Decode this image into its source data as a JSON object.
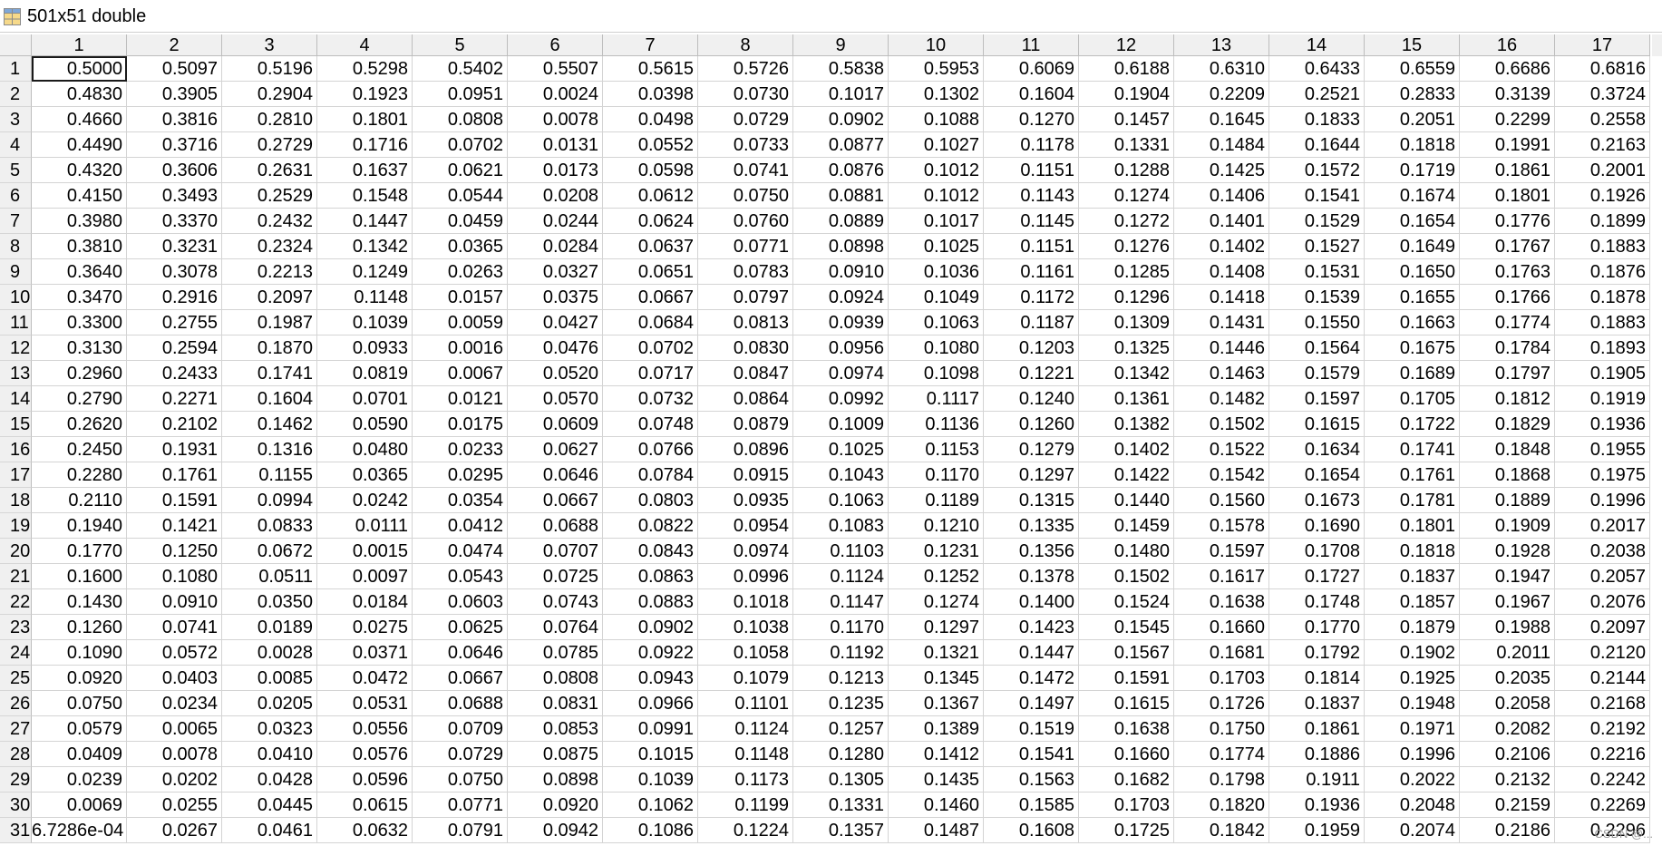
{
  "window": {
    "title": "501x51 double",
    "icon": "variable-table-icon"
  },
  "columns": [
    "1",
    "2",
    "3",
    "4",
    "5",
    "6",
    "7",
    "8",
    "9",
    "10",
    "11",
    "12",
    "13",
    "14",
    "15",
    "16",
    "17"
  ],
  "rows": [
    {
      "label": "1",
      "cells": [
        "0.5000",
        "0.5097",
        "0.5196",
        "0.5298",
        "0.5402",
        "0.5507",
        "0.5615",
        "0.5726",
        "0.5838",
        "0.5953",
        "0.6069",
        "0.6188",
        "0.6310",
        "0.6433",
        "0.6559",
        "0.6686",
        "0.6816"
      ]
    },
    {
      "label": "2",
      "cells": [
        "0.4830",
        "0.3905",
        "0.2904",
        "0.1923",
        "0.0951",
        "0.0024",
        "0.0398",
        "0.0730",
        "0.1017",
        "0.1302",
        "0.1604",
        "0.1904",
        "0.2209",
        "0.2521",
        "0.2833",
        "0.3139",
        "0.3724"
      ]
    },
    {
      "label": "3",
      "cells": [
        "0.4660",
        "0.3816",
        "0.2810",
        "0.1801",
        "0.0808",
        "0.0078",
        "0.0498",
        "0.0729",
        "0.0902",
        "0.1088",
        "0.1270",
        "0.1457",
        "0.1645",
        "0.1833",
        "0.2051",
        "0.2299",
        "0.2558"
      ]
    },
    {
      "label": "4",
      "cells": [
        "0.4490",
        "0.3716",
        "0.2729",
        "0.1716",
        "0.0702",
        "0.0131",
        "0.0552",
        "0.0733",
        "0.0877",
        "0.1027",
        "0.1178",
        "0.1331",
        "0.1484",
        "0.1644",
        "0.1818",
        "0.1991",
        "0.2163"
      ]
    },
    {
      "label": "5",
      "cells": [
        "0.4320",
        "0.3606",
        "0.2631",
        "0.1637",
        "0.0621",
        "0.0173",
        "0.0598",
        "0.0741",
        "0.0876",
        "0.1012",
        "0.1151",
        "0.1288",
        "0.1425",
        "0.1572",
        "0.1719",
        "0.1861",
        "0.2001"
      ]
    },
    {
      "label": "6",
      "cells": [
        "0.4150",
        "0.3493",
        "0.2529",
        "0.1548",
        "0.0544",
        "0.0208",
        "0.0612",
        "0.0750",
        "0.0881",
        "0.1012",
        "0.1143",
        "0.1274",
        "0.1406",
        "0.1541",
        "0.1674",
        "0.1801",
        "0.1926"
      ]
    },
    {
      "label": "7",
      "cells": [
        "0.3980",
        "0.3370",
        "0.2432",
        "0.1447",
        "0.0459",
        "0.0244",
        "0.0624",
        "0.0760",
        "0.0889",
        "0.1017",
        "0.1145",
        "0.1272",
        "0.1401",
        "0.1529",
        "0.1654",
        "0.1776",
        "0.1899"
      ]
    },
    {
      "label": "8",
      "cells": [
        "0.3810",
        "0.3231",
        "0.2324",
        "0.1342",
        "0.0365",
        "0.0284",
        "0.0637",
        "0.0771",
        "0.0898",
        "0.1025",
        "0.1151",
        "0.1276",
        "0.1402",
        "0.1527",
        "0.1649",
        "0.1767",
        "0.1883"
      ]
    },
    {
      "label": "9",
      "cells": [
        "0.3640",
        "0.3078",
        "0.2213",
        "0.1249",
        "0.0263",
        "0.0327",
        "0.0651",
        "0.0783",
        "0.0910",
        "0.1036",
        "0.1161",
        "0.1285",
        "0.1408",
        "0.1531",
        "0.1650",
        "0.1763",
        "0.1876"
      ]
    },
    {
      "label": "10",
      "cells": [
        "0.3470",
        "0.2916",
        "0.2097",
        "0.1148",
        "0.0157",
        "0.0375",
        "0.0667",
        "0.0797",
        "0.0924",
        "0.1049",
        "0.1172",
        "0.1296",
        "0.1418",
        "0.1539",
        "0.1655",
        "0.1766",
        "0.1878"
      ]
    },
    {
      "label": "11",
      "cells": [
        "0.3300",
        "0.2755",
        "0.1987",
        "0.1039",
        "0.0059",
        "0.0427",
        "0.0684",
        "0.0813",
        "0.0939",
        "0.1063",
        "0.1187",
        "0.1309",
        "0.1431",
        "0.1550",
        "0.1663",
        "0.1774",
        "0.1883"
      ]
    },
    {
      "label": "12",
      "cells": [
        "0.3130",
        "0.2594",
        "0.1870",
        "0.0933",
        "0.0016",
        "0.0476",
        "0.0702",
        "0.0830",
        "0.0956",
        "0.1080",
        "0.1203",
        "0.1325",
        "0.1446",
        "0.1564",
        "0.1675",
        "0.1784",
        "0.1893"
      ]
    },
    {
      "label": "13",
      "cells": [
        "0.2960",
        "0.2433",
        "0.1741",
        "0.0819",
        "0.0067",
        "0.0520",
        "0.0717",
        "0.0847",
        "0.0974",
        "0.1098",
        "0.1221",
        "0.1342",
        "0.1463",
        "0.1579",
        "0.1689",
        "0.1797",
        "0.1905"
      ]
    },
    {
      "label": "14",
      "cells": [
        "0.2790",
        "0.2271",
        "0.1604",
        "0.0701",
        "0.0121",
        "0.0570",
        "0.0732",
        "0.0864",
        "0.0992",
        "0.1117",
        "0.1240",
        "0.1361",
        "0.1482",
        "0.1597",
        "0.1705",
        "0.1812",
        "0.1919"
      ]
    },
    {
      "label": "15",
      "cells": [
        "0.2620",
        "0.2102",
        "0.1462",
        "0.0590",
        "0.0175",
        "0.0609",
        "0.0748",
        "0.0879",
        "0.1009",
        "0.1136",
        "0.1260",
        "0.1382",
        "0.1502",
        "0.1615",
        "0.1722",
        "0.1829",
        "0.1936"
      ]
    },
    {
      "label": "16",
      "cells": [
        "0.2450",
        "0.1931",
        "0.1316",
        "0.0480",
        "0.0233",
        "0.0627",
        "0.0766",
        "0.0896",
        "0.1025",
        "0.1153",
        "0.1279",
        "0.1402",
        "0.1522",
        "0.1634",
        "0.1741",
        "0.1848",
        "0.1955"
      ]
    },
    {
      "label": "17",
      "cells": [
        "0.2280",
        "0.1761",
        "0.1155",
        "0.0365",
        "0.0295",
        "0.0646",
        "0.0784",
        "0.0915",
        "0.1043",
        "0.1170",
        "0.1297",
        "0.1422",
        "0.1542",
        "0.1654",
        "0.1761",
        "0.1868",
        "0.1975"
      ]
    },
    {
      "label": "18",
      "cells": [
        "0.2110",
        "0.1591",
        "0.0994",
        "0.0242",
        "0.0354",
        "0.0667",
        "0.0803",
        "0.0935",
        "0.1063",
        "0.1189",
        "0.1315",
        "0.1440",
        "0.1560",
        "0.1673",
        "0.1781",
        "0.1889",
        "0.1996"
      ]
    },
    {
      "label": "19",
      "cells": [
        "0.1940",
        "0.1421",
        "0.0833",
        "0.0111",
        "0.0412",
        "0.0688",
        "0.0822",
        "0.0954",
        "0.1083",
        "0.1210",
        "0.1335",
        "0.1459",
        "0.1578",
        "0.1690",
        "0.1801",
        "0.1909",
        "0.2017"
      ]
    },
    {
      "label": "20",
      "cells": [
        "0.1770",
        "0.1250",
        "0.0672",
        "0.0015",
        "0.0474",
        "0.0707",
        "0.0843",
        "0.0974",
        "0.1103",
        "0.1231",
        "0.1356",
        "0.1480",
        "0.1597",
        "0.1708",
        "0.1818",
        "0.1928",
        "0.2038"
      ]
    },
    {
      "label": "21",
      "cells": [
        "0.1600",
        "0.1080",
        "0.0511",
        "0.0097",
        "0.0543",
        "0.0725",
        "0.0863",
        "0.0996",
        "0.1124",
        "0.1252",
        "0.1378",
        "0.1502",
        "0.1617",
        "0.1727",
        "0.1837",
        "0.1947",
        "0.2057"
      ]
    },
    {
      "label": "22",
      "cells": [
        "0.1430",
        "0.0910",
        "0.0350",
        "0.0184",
        "0.0603",
        "0.0743",
        "0.0883",
        "0.1018",
        "0.1147",
        "0.1274",
        "0.1400",
        "0.1524",
        "0.1638",
        "0.1748",
        "0.1857",
        "0.1967",
        "0.2076"
      ]
    },
    {
      "label": "23",
      "cells": [
        "0.1260",
        "0.0741",
        "0.0189",
        "0.0275",
        "0.0625",
        "0.0764",
        "0.0902",
        "0.1038",
        "0.1170",
        "0.1297",
        "0.1423",
        "0.1545",
        "0.1660",
        "0.1770",
        "0.1879",
        "0.1988",
        "0.2097"
      ]
    },
    {
      "label": "24",
      "cells": [
        "0.1090",
        "0.0572",
        "0.0028",
        "0.0371",
        "0.0646",
        "0.0785",
        "0.0922",
        "0.1058",
        "0.1192",
        "0.1321",
        "0.1447",
        "0.1567",
        "0.1681",
        "0.1792",
        "0.1902",
        "0.2011",
        "0.2120"
      ]
    },
    {
      "label": "25",
      "cells": [
        "0.0920",
        "0.0403",
        "0.0085",
        "0.0472",
        "0.0667",
        "0.0808",
        "0.0943",
        "0.1079",
        "0.1213",
        "0.1345",
        "0.1472",
        "0.1591",
        "0.1703",
        "0.1814",
        "0.1925",
        "0.2035",
        "0.2144"
      ]
    },
    {
      "label": "26",
      "cells": [
        "0.0750",
        "0.0234",
        "0.0205",
        "0.0531",
        "0.0688",
        "0.0831",
        "0.0966",
        "0.1101",
        "0.1235",
        "0.1367",
        "0.1497",
        "0.1615",
        "0.1726",
        "0.1837",
        "0.1948",
        "0.2058",
        "0.2168"
      ]
    },
    {
      "label": "27",
      "cells": [
        "0.0579",
        "0.0065",
        "0.0323",
        "0.0556",
        "0.0709",
        "0.0853",
        "0.0991",
        "0.1124",
        "0.1257",
        "0.1389",
        "0.1519",
        "0.1638",
        "0.1750",
        "0.1861",
        "0.1971",
        "0.2082",
        "0.2192"
      ]
    },
    {
      "label": "28",
      "cells": [
        "0.0409",
        "0.0078",
        "0.0410",
        "0.0576",
        "0.0729",
        "0.0875",
        "0.1015",
        "0.1148",
        "0.1280",
        "0.1412",
        "0.1541",
        "0.1660",
        "0.1774",
        "0.1886",
        "0.1996",
        "0.2106",
        "0.2216"
      ]
    },
    {
      "label": "29",
      "cells": [
        "0.0239",
        "0.0202",
        "0.0428",
        "0.0596",
        "0.0750",
        "0.0898",
        "0.1039",
        "0.1173",
        "0.1305",
        "0.1435",
        "0.1563",
        "0.1682",
        "0.1798",
        "0.1911",
        "0.2022",
        "0.2132",
        "0.2242"
      ]
    },
    {
      "label": "30",
      "cells": [
        "0.0069",
        "0.0255",
        "0.0445",
        "0.0615",
        "0.0771",
        "0.0920",
        "0.1062",
        "0.1199",
        "0.1331",
        "0.1460",
        "0.1585",
        "0.1703",
        "0.1820",
        "0.1936",
        "0.2048",
        "0.2159",
        "0.2269"
      ]
    },
    {
      "label": "31",
      "cells": [
        "6.7286e-04",
        "0.0267",
        "0.0461",
        "0.0632",
        "0.0791",
        "0.0942",
        "0.1086",
        "0.1224",
        "0.1357",
        "0.1487",
        "0.1608",
        "0.1725",
        "0.1842",
        "0.1959",
        "0.2074",
        "0.2186",
        "0.2296"
      ]
    }
  ],
  "selected_cell": {
    "row": "1",
    "column": "1"
  },
  "watermark": "CSDN @..."
}
